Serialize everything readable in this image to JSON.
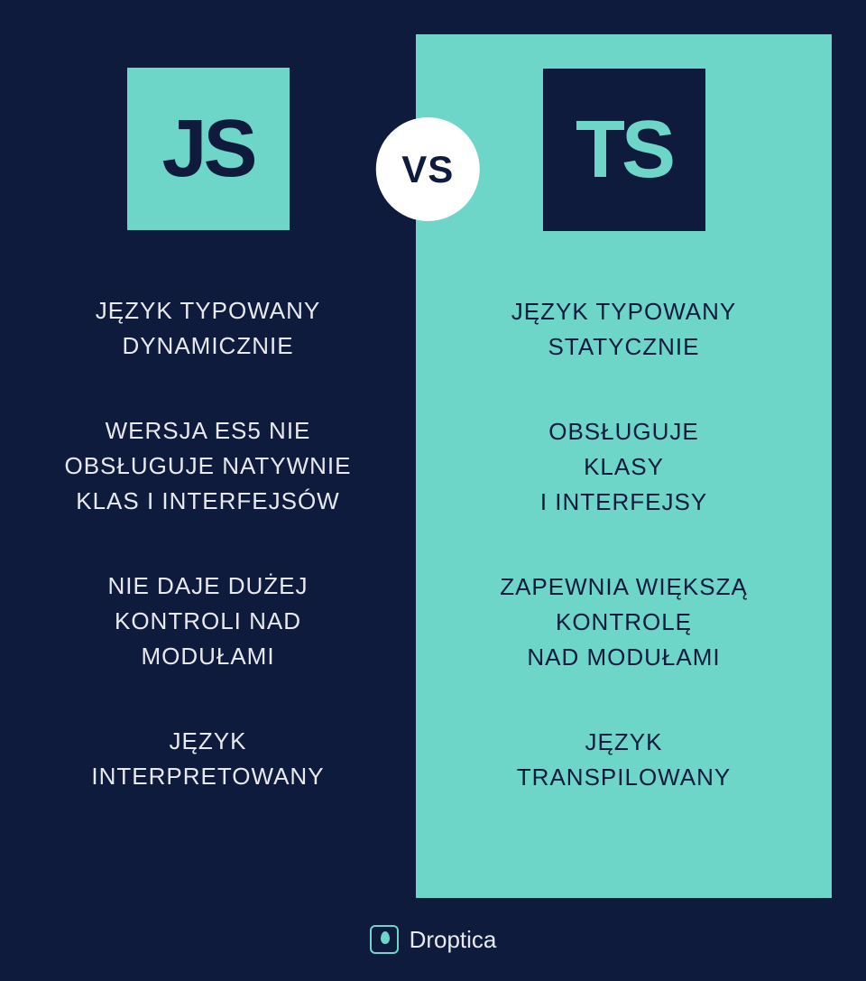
{
  "vs_label": "VS",
  "left": {
    "logo": "JS",
    "features": [
      [
        "JĘZYK TYPOWANY",
        "DYNAMICZNIE"
      ],
      [
        "WERSJA ES5 NIE",
        "OBSŁUGUJE NATYWNIE",
        "KLAS I INTERFEJSÓW"
      ],
      [
        "NIE DAJE DUŻEJ",
        "KONTROLI NAD",
        "MODUŁAMI"
      ],
      [
        "JĘZYK",
        "INTERPRETOWANY"
      ]
    ]
  },
  "right": {
    "logo": "TS",
    "features": [
      [
        "JĘZYK TYPOWANY",
        "STATYCZNIE"
      ],
      [
        "OBSŁUGUJE",
        "KLASY",
        "I INTERFEJSY"
      ],
      [
        "ZAPEWNIA WIĘKSZĄ",
        "KONTROLĘ",
        "NAD MODUŁAMI"
      ],
      [
        "JĘZYK",
        "TRANSPILOWANY"
      ]
    ]
  },
  "footer": {
    "brand": "Droptica"
  }
}
